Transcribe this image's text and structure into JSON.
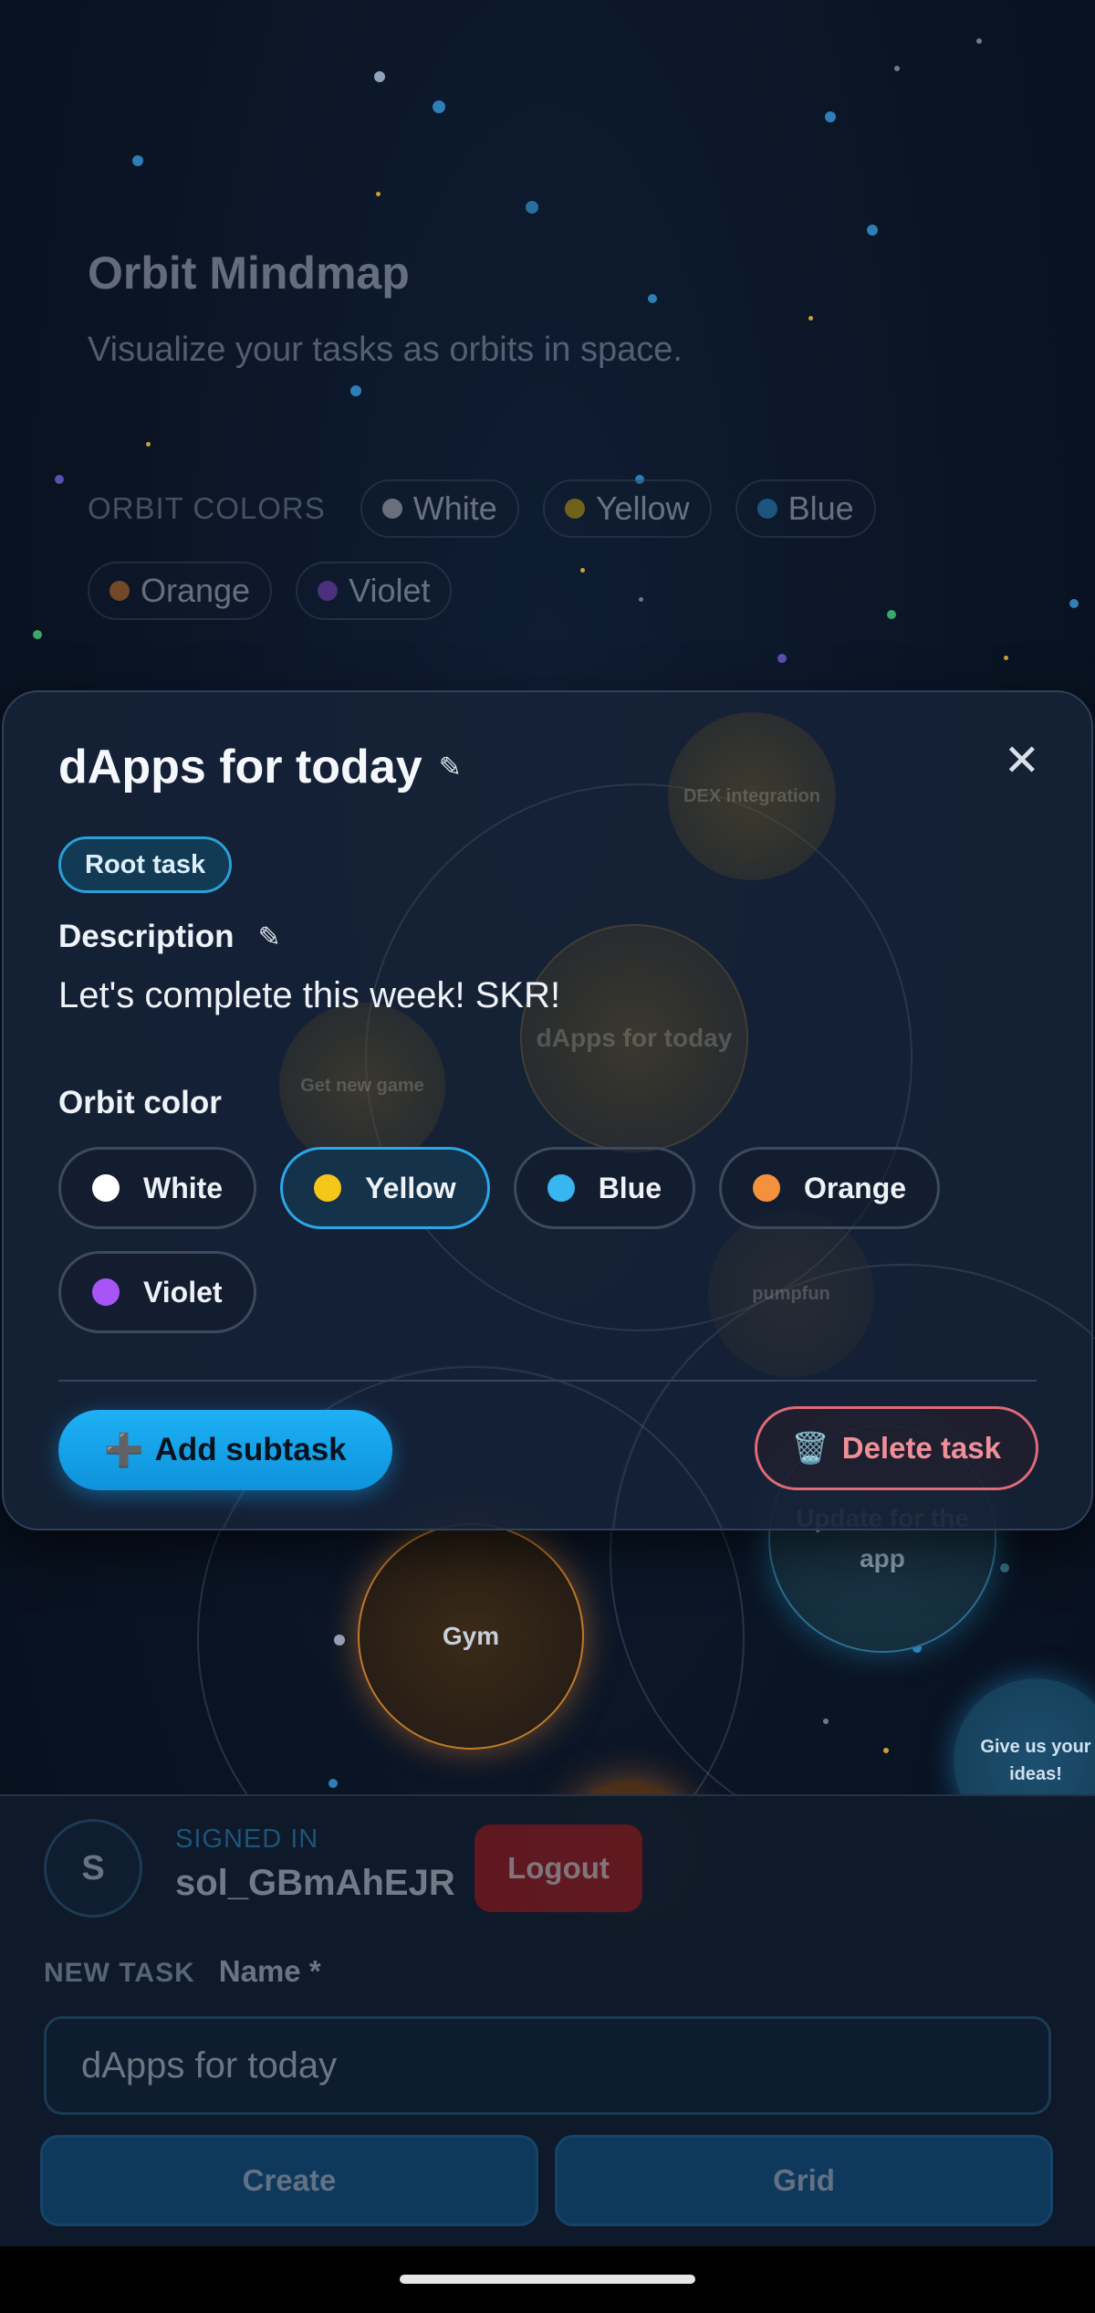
{
  "header": {
    "title": "Orbit Mindmap",
    "subtitle": "Visualize your tasks as orbits in space."
  },
  "legend": {
    "label": "ORBIT COLORS",
    "items": [
      {
        "label": "White",
        "color": "#d9d9d9"
      },
      {
        "label": "Yellow",
        "color": "#e6b800"
      },
      {
        "label": "Blue",
        "color": "#2f9fe0"
      },
      {
        "label": "Orange",
        "color": "#f08a2c"
      },
      {
        "label": "Violet",
        "color": "#9b4fe0"
      }
    ]
  },
  "mindmap": {
    "nodes": [
      {
        "label": "dApps for today"
      },
      {
        "label": "DEX integration"
      },
      {
        "label": "Get new game"
      },
      {
        "label": "pumpfun"
      },
      {
        "label": "Gym"
      },
      {
        "label": "Update for the app"
      },
      {
        "label": "Give us your ideas!"
      }
    ]
  },
  "modal": {
    "title": "dApps for today",
    "badge": "Root task",
    "description_label": "Description",
    "description": "Let's complete this week! SKR!",
    "orbit_color_label": "Orbit color",
    "colors": [
      {
        "label": "White",
        "color": "#ffffff",
        "selected": false
      },
      {
        "label": "Yellow",
        "color": "#f5c518",
        "selected": true
      },
      {
        "label": "Blue",
        "color": "#38b6f0",
        "selected": false
      },
      {
        "label": "Orange",
        "color": "#f5913c",
        "selected": false
      },
      {
        "label": "Violet",
        "color": "#a855f7",
        "selected": false
      }
    ],
    "add_button": "Add subtask",
    "add_icon": "➕",
    "delete_button": "Delete task",
    "delete_icon": "🗑️"
  },
  "account": {
    "avatar_initial": "S",
    "signed_in_label": "SIGNED IN",
    "username": "sol_GBmAhEJR",
    "logout": "Logout"
  },
  "new_task": {
    "label": "NEW TASK",
    "name_label": "Name *",
    "name_value": "dApps for today",
    "create": "Create",
    "grid": "Grid"
  }
}
